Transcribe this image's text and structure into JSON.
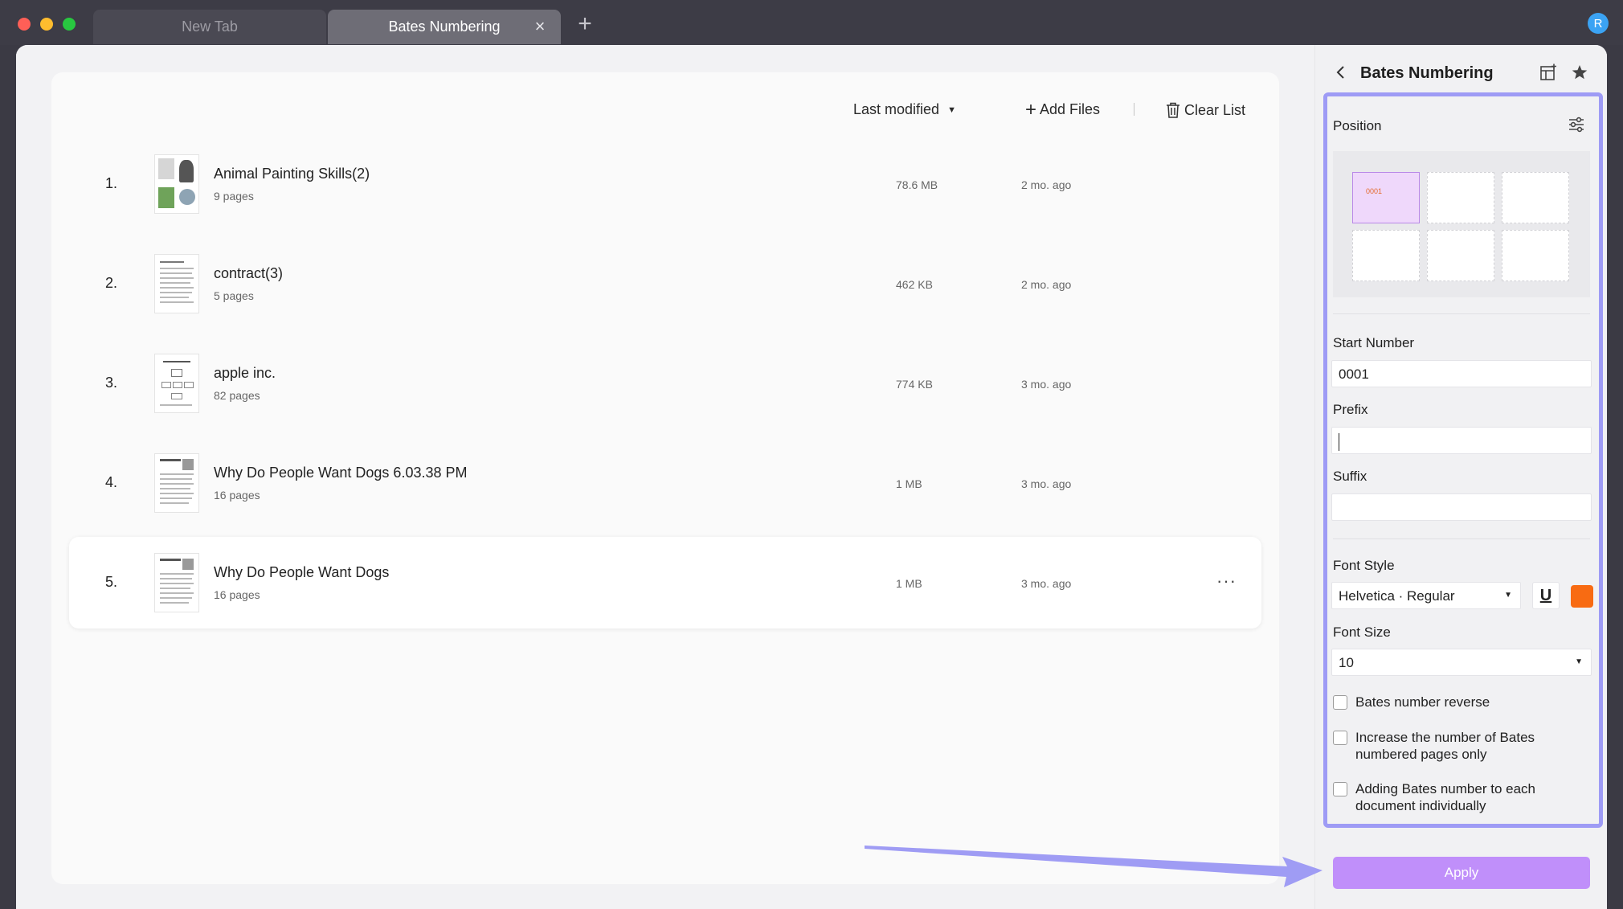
{
  "tabs": [
    {
      "label": "New Tab",
      "active": false
    },
    {
      "label": "Bates Numbering",
      "active": true
    }
  ],
  "user": {
    "avatar_initial": "R"
  },
  "toolbar": {
    "sort_label": "Last modified",
    "add_label": "Add Files",
    "clear_label": "Clear List"
  },
  "files": [
    {
      "index": "1.",
      "name": "Animal Painting Skills(2)",
      "pages": "9 pages",
      "size": "78.6 MB",
      "modified": "2 mo. ago"
    },
    {
      "index": "2.",
      "name": "contract(3)",
      "pages": "5 pages",
      "size": "462 KB",
      "modified": "2 mo. ago"
    },
    {
      "index": "3.",
      "name": "apple inc.",
      "pages": "82 pages",
      "size": "774 KB",
      "modified": "3 mo. ago"
    },
    {
      "index": "4.",
      "name": "Why Do People Want Dogs 6.03.38 PM",
      "pages": "16 pages",
      "size": "1 MB",
      "modified": "3 mo. ago"
    },
    {
      "index": "5.",
      "name": "Why Do People Want Dogs",
      "pages": "16 pages",
      "size": "1 MB",
      "modified": "3 mo. ago",
      "more": "···"
    }
  ],
  "panel": {
    "title": "Bates Numbering",
    "position_label": "Position",
    "position_preview_number": "0001",
    "start_number_label": "Start Number",
    "start_number_value": "0001",
    "prefix_label": "Prefix",
    "prefix_value": "",
    "suffix_label": "Suffix",
    "suffix_value": "",
    "font_style_label": "Font Style",
    "font_style_value": "Helvetica · Regular",
    "underline_label": "U",
    "font_color": "#f86b12",
    "font_size_label": "Font Size",
    "font_size_value": "10",
    "checks": [
      "Bates number reverse",
      "Increase the number of Bates numbered pages only",
      "Adding Bates number to each document individually"
    ],
    "apply_label": "Apply"
  },
  "colors": {
    "accent": "#c08ffa",
    "highlight": "#9e9bf5",
    "annotation_arrow": "#9f9cf4"
  }
}
